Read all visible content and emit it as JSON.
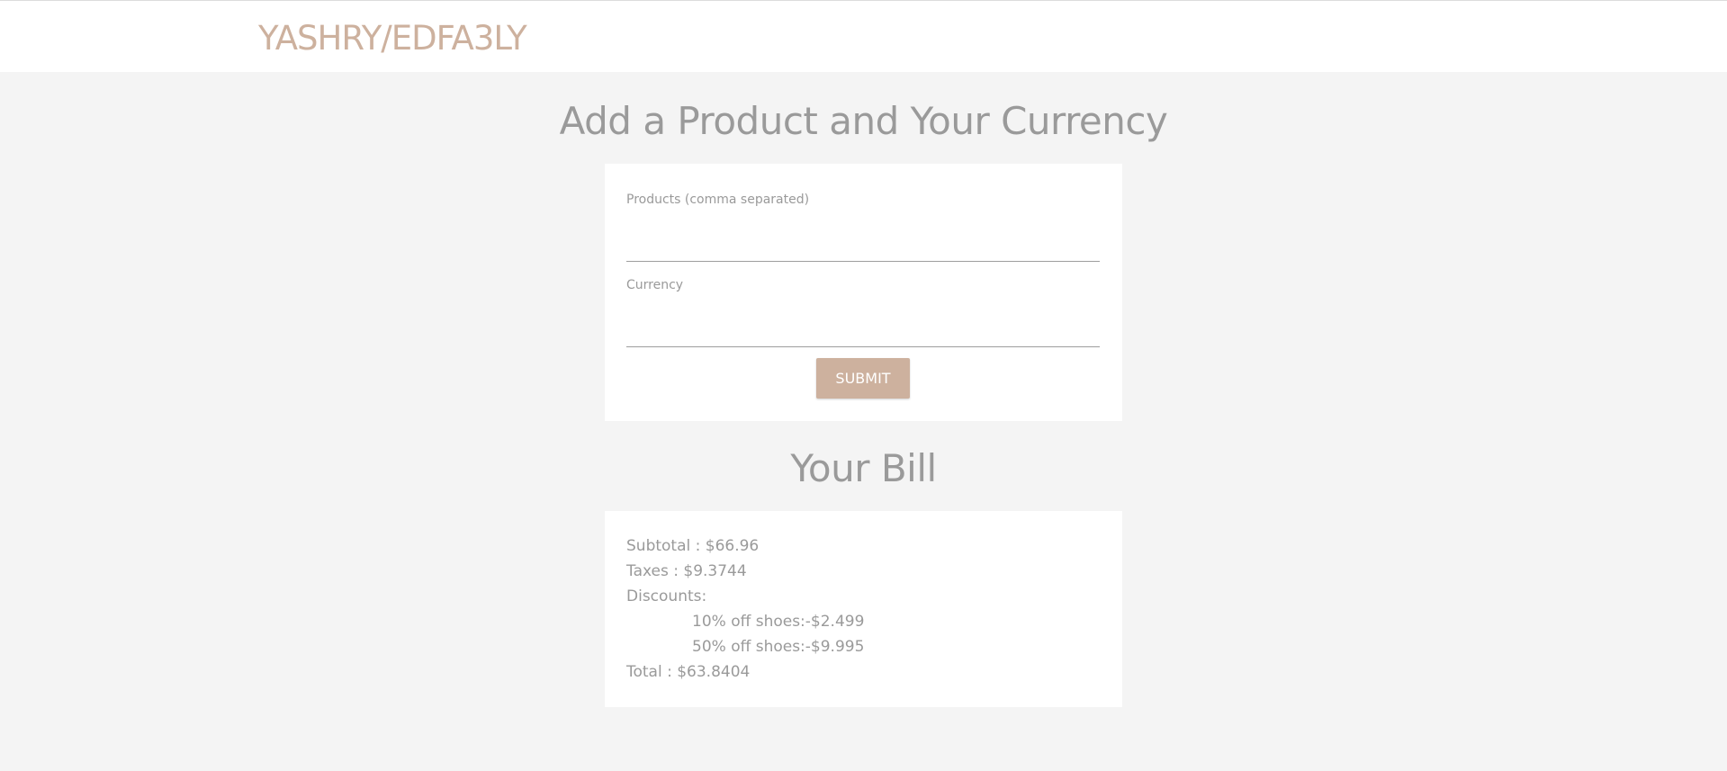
{
  "navbar": {
    "brand": "YASHRY/EDFA3LY"
  },
  "form_section": {
    "heading": "Add a Product and Your Currency",
    "products_label": "Products (comma separated)",
    "products_value": "",
    "currency_label": "Currency",
    "currency_value": "",
    "submit_label": "SUBMIT"
  },
  "bill_section": {
    "heading": "Your Bill",
    "subtotal": "Subtotal : $66.96",
    "taxes": "Taxes : $9.3744",
    "discounts_label": "Discounts:",
    "discounts": [
      "10% off shoes:-$2.499",
      "50% off shoes:-$9.995"
    ],
    "total": "Total : $63.8404"
  },
  "colors": {
    "accent": "#cdb19e",
    "background": "#f4f4f4",
    "card": "#ffffff",
    "text": "#9a9a9a"
  }
}
